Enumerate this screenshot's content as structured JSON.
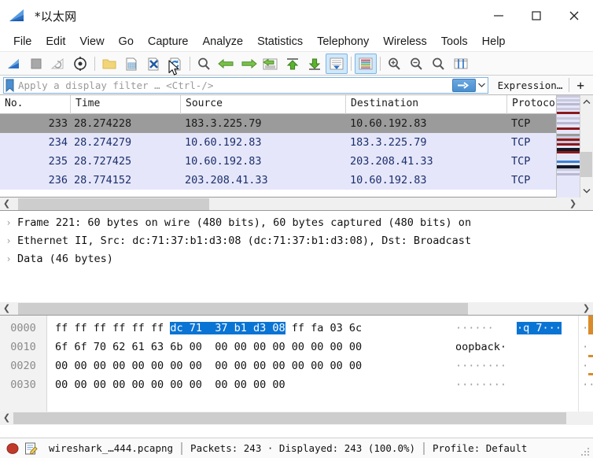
{
  "window": {
    "title": "*以太网",
    "app_icon": "wireshark-fin-icon",
    "controls": {
      "minimize": "minimize-icon",
      "maximize": "maximize-icon",
      "close": "close-icon"
    }
  },
  "menu": {
    "items": [
      "File",
      "Edit",
      "View",
      "Go",
      "Capture",
      "Analyze",
      "Statistics",
      "Telephony",
      "Wireless",
      "Tools",
      "Help"
    ]
  },
  "toolbar": {
    "buttons": [
      "start-capture-icon",
      "stop-capture-icon",
      "restart-capture-icon",
      "capture-options-icon",
      "open-file-icon",
      "save-file-icon",
      "close-file-icon",
      "reload-file-icon",
      "find-packet-icon",
      "go-back-icon",
      "go-forward-icon",
      "go-to-packet-icon",
      "go-first-packet-icon",
      "go-last-packet-icon",
      "auto-scroll-icon",
      "colorize-icon",
      "zoom-in-icon",
      "zoom-out-icon",
      "zoom-reset-icon",
      "resize-columns-icon"
    ]
  },
  "filter": {
    "bookmark_icon": "filter-bookmark-icon",
    "placeholder": "Apply a display filter … <Ctrl-/>",
    "value": "",
    "apply_icon": "apply-filter-arrow-icon",
    "dropdown_icon": "filter-history-chevron-icon",
    "expression_label": "Expression…",
    "add_button_label": "+"
  },
  "packet_list": {
    "columns": [
      "No.",
      "Time",
      "Source",
      "Destination",
      "Protocol"
    ],
    "rows": [
      {
        "no": "233",
        "time": "28.274228",
        "source": "183.3.225.79",
        "destination": "10.60.192.83",
        "protocol": "TCP",
        "selected": true
      },
      {
        "no": "234",
        "time": "28.274279",
        "source": "10.60.192.83",
        "destination": "183.3.225.79",
        "protocol": "TCP",
        "selected": false
      },
      {
        "no": "235",
        "time": "28.727425",
        "source": "10.60.192.83",
        "destination": "203.208.41.33",
        "protocol": "TCP",
        "selected": false
      },
      {
        "no": "236",
        "time": "28.774152",
        "source": "203.208.41.33",
        "destination": "10.60.192.83",
        "protocol": "TCP",
        "selected": false
      }
    ],
    "scroll_up_icon": "chevron-up-icon",
    "scroll_down_icon": "chevron-down-icon",
    "hscroll_left_icon": "chevron-left-icon",
    "hscroll_right_icon": "chevron-right-icon"
  },
  "packet_detail": {
    "lines": [
      {
        "caret": "›",
        "text": "Frame 221: 60 bytes on wire (480 bits), 60 bytes captured (480 bits) on"
      },
      {
        "caret": "›",
        "text": "Ethernet II, Src: dc:71:37:b1:d3:08 (dc:71:37:b1:d3:08), Dst: Broadcast"
      },
      {
        "caret": "›",
        "text": "Data (46 bytes)"
      }
    ]
  },
  "hex_dump": {
    "rows": [
      {
        "offset": "0000",
        "b1": "ff ff ff ff ff ff ",
        "b2": "dc 71 ",
        "b3": " 37 b1 d3 08",
        "b4": " ff fa 03 6c",
        "a1": "······",
        "a2": "·q 7···",
        "a3": " ···l"
      },
      {
        "offset": "0010",
        "b1": "6f 6f 70 62 61 63 6b 00 ",
        "b2": "",
        "b3": "",
        "b4": " 00 00 00 00 00 00 00 00",
        "a1": "oopback·",
        "a2": "",
        "a3": " ········"
      },
      {
        "offset": "0020",
        "b1": "00 00 00 00 00 00 00 00 ",
        "b2": "",
        "b3": "",
        "b4": " 00 00 00 00 00 00 00 00",
        "a1": "········",
        "a2": "",
        "a3": " ········"
      },
      {
        "offset": "0030",
        "b1": "00 00 00 00 00 00 00 00 ",
        "b2": "",
        "b3": "",
        "b4": " 00 00 00 00",
        "a1": "········",
        "a2": "",
        "a3": " ····"
      }
    ]
  },
  "status_bar": {
    "capture_icon": "stop-capture-status-icon",
    "notes_icon": "capture-comment-icon",
    "file_name": "wireshark_…444.pcapng",
    "counts": "Packets: 243 · Displayed: 243 (100.0%)",
    "profile": "Profile: Default",
    "grip_icon": "resize-grip-icon"
  },
  "colors": {
    "selection_blue": "#0a74d4",
    "row_selected_gray": "#9b9b9b",
    "row_alt_lavender": "#e6e6fa",
    "accent_blue": "#4a8fcf",
    "text_blue": "#1a2f6b"
  }
}
